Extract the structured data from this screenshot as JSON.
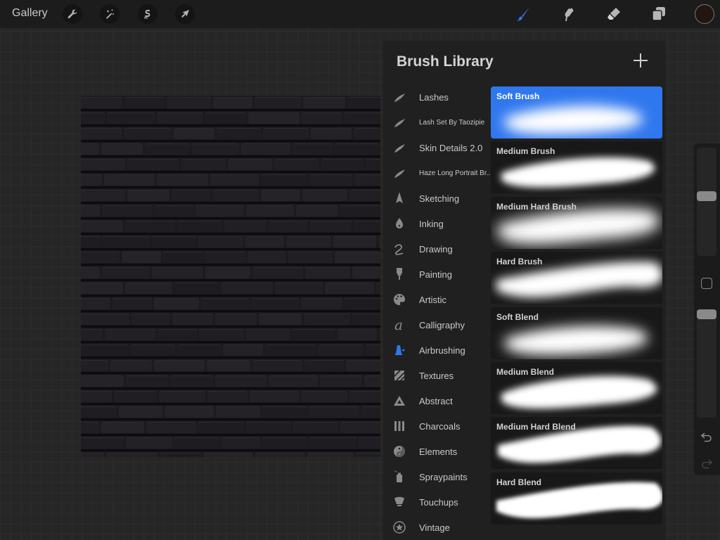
{
  "topbar": {
    "gallery_label": "Gallery",
    "left_tools": [
      {
        "name": "actions",
        "icon": "wrench-icon"
      },
      {
        "name": "adjustments",
        "icon": "magic-wand-icon"
      },
      {
        "name": "selection",
        "icon": "selection-s-icon"
      },
      {
        "name": "transform",
        "icon": "arrow-cursor-icon"
      }
    ],
    "right_tools": [
      {
        "name": "brush",
        "icon": "paintbrush-icon",
        "active": true
      },
      {
        "name": "smudge",
        "icon": "smudge-finger-icon",
        "active": false
      },
      {
        "name": "eraser",
        "icon": "eraser-icon",
        "active": false
      },
      {
        "name": "layers",
        "icon": "layers-icon",
        "active": false
      }
    ],
    "current_color": "#231610",
    "accent_color": "#2f77ee"
  },
  "brush_library": {
    "title": "Brush Library",
    "add_label": "+",
    "sets": [
      {
        "label": "Lashes",
        "icon": "stroke-swoosh-icon",
        "small": false,
        "active": false
      },
      {
        "label": "Lash Set By Taozipie",
        "icon": "stroke-swoosh-icon",
        "small": true,
        "active": false
      },
      {
        "label": "Skin Details 2.0",
        "icon": "stroke-swoosh-icon",
        "small": false,
        "active": false
      },
      {
        "label": "Haze Long Portrait Br...",
        "icon": "stroke-swoosh-icon",
        "small": true,
        "active": false
      },
      {
        "label": "Sketching",
        "icon": "pencil-tip-icon",
        "small": false,
        "active": false
      },
      {
        "label": "Inking",
        "icon": "pen-nib-icon",
        "small": false,
        "active": false
      },
      {
        "label": "Drawing",
        "icon": "squiggle-icon",
        "small": false,
        "active": false
      },
      {
        "label": "Painting",
        "icon": "paint-brush-icon",
        "small": false,
        "active": false
      },
      {
        "label": "Artistic",
        "icon": "palette-icon",
        "small": false,
        "active": false
      },
      {
        "label": "Calligraphy",
        "icon": "calligraphy-a-icon",
        "small": false,
        "active": false
      },
      {
        "label": "Airbrushing",
        "icon": "airbrush-icon",
        "small": false,
        "active": true
      },
      {
        "label": "Textures",
        "icon": "texture-hatch-icon",
        "small": false,
        "active": false
      },
      {
        "label": "Abstract",
        "icon": "triangle-icon",
        "small": false,
        "active": false
      },
      {
        "label": "Charcoals",
        "icon": "charcoal-sticks-icon",
        "small": false,
        "active": false
      },
      {
        "label": "Elements",
        "icon": "yin-yang-icon",
        "small": false,
        "active": false
      },
      {
        "label": "Spraypaints",
        "icon": "spray-can-icon",
        "small": false,
        "active": false
      },
      {
        "label": "Touchups",
        "icon": "makeup-brush-icon",
        "small": false,
        "active": false
      },
      {
        "label": "Vintage",
        "icon": "star-badge-icon",
        "small": false,
        "active": false
      }
    ],
    "brushes": [
      {
        "name": "Soft Brush",
        "selected": true
      },
      {
        "name": "Medium Brush",
        "selected": false
      },
      {
        "name": "Medium Hard Brush",
        "selected": false
      },
      {
        "name": "Hard Brush",
        "selected": false
      },
      {
        "name": "Soft Blend",
        "selected": false
      },
      {
        "name": "Medium Blend",
        "selected": false
      },
      {
        "name": "Medium Hard Blend",
        "selected": false
      },
      {
        "name": "Hard Blend",
        "selected": false
      }
    ]
  },
  "sidebar": {
    "brush_size_fraction": 0.56,
    "opacity_fraction": 1.0
  }
}
